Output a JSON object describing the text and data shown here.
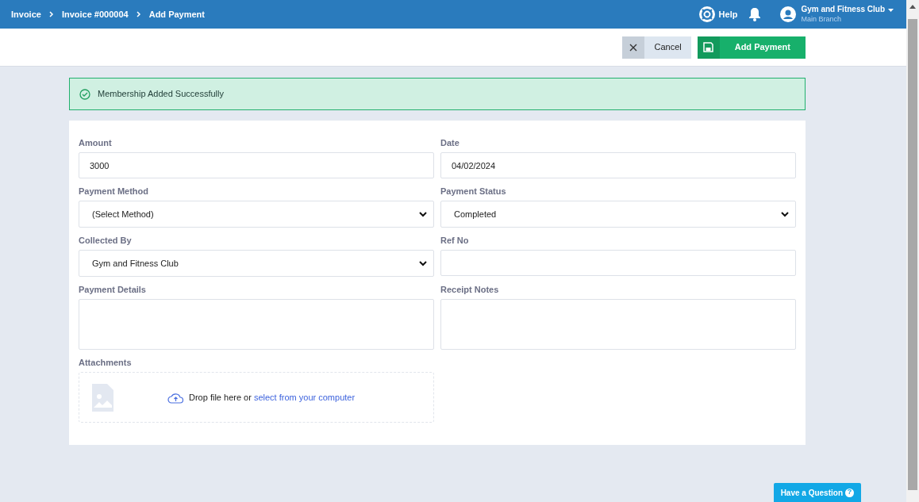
{
  "breadcrumbs": [
    {
      "label": "Invoice"
    },
    {
      "label": "Invoice #000004"
    },
    {
      "label": "Add Payment"
    }
  ],
  "header": {
    "help": "Help",
    "user_name": "Gym and Fitness Club",
    "branch": "Main Branch"
  },
  "toolbar": {
    "cancel": "Cancel",
    "submit": "Add Payment"
  },
  "alert": {
    "message": "Membership Added Successfully"
  },
  "fields": [
    {
      "label": "Amount",
      "kind": "text",
      "value": "3000"
    },
    {
      "label": "Date",
      "kind": "text",
      "value": "04/02/2024"
    },
    {
      "label": "Payment Method",
      "kind": "select",
      "value": "(Select Method)"
    },
    {
      "label": "Payment Status",
      "kind": "select",
      "value": "Completed"
    },
    {
      "label": "Collected By",
      "kind": "select",
      "value": "Gym and Fitness Club"
    },
    {
      "label": "Ref No",
      "kind": "text"
    },
    {
      "label": "Payment Details",
      "kind": "textarea"
    },
    {
      "label": "Receipt Notes",
      "kind": "textarea"
    }
  ],
  "attachments": {
    "label": "Attachments",
    "text": "Drop file here or",
    "link": "select from your computer"
  },
  "help_button": "Have a Question",
  "help_icon": "?"
}
